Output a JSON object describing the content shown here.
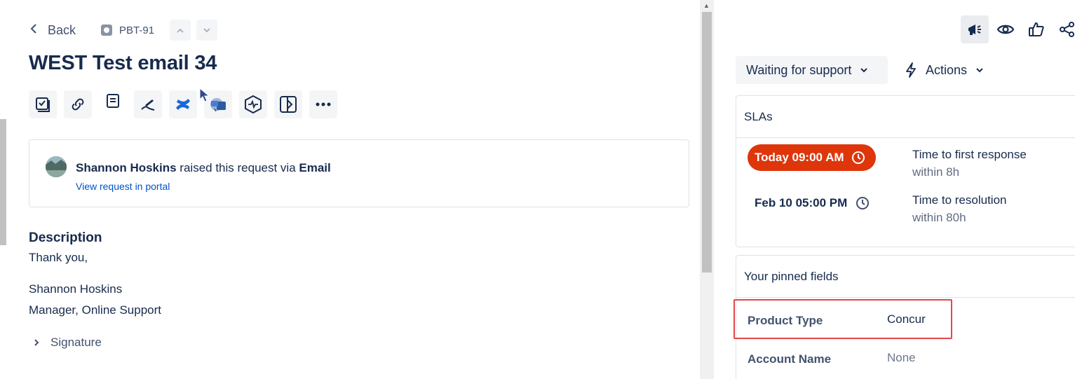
{
  "header": {
    "back_label": "Back",
    "issue_key": "PBT-91",
    "title": "WEST Test email 34"
  },
  "toolbar_icons": [
    "checklist-icon",
    "link-icon",
    "document-icon",
    "pen-icon",
    "confluence-icon",
    "chat-app-icon",
    "heartbeat-icon",
    "split-panel-icon",
    "more-icon"
  ],
  "request": {
    "reporter": "Shannon Hoskins",
    "raised_text": " raised this request via ",
    "channel": "Email",
    "portal_link": "View request in portal"
  },
  "description": {
    "heading": "Description",
    "lines": [
      "Thank you,",
      "Shannon Hoskins",
      "Manager, Online Support"
    ],
    "signature_toggle": "Signature"
  },
  "side": {
    "status_label": "Waiting for support",
    "actions_label": "Actions",
    "slas": {
      "heading": "SLAs",
      "items": [
        {
          "time": "Today 09:00 AM",
          "name": "Time to first response",
          "within": "within 8h",
          "status_color": "#de350b"
        },
        {
          "time": "Feb 10 05:00 PM",
          "name": "Time to resolution",
          "within": "within 80h"
        }
      ]
    },
    "pinned": {
      "heading": "Your pinned fields",
      "fields": [
        {
          "label": "Product Type",
          "value": "Concur"
        },
        {
          "label": "Account Name",
          "value": "None"
        }
      ]
    }
  },
  "colors": {
    "accent": "#0052cc",
    "breach": "#de350b",
    "highlight_box": "#e0474c"
  }
}
